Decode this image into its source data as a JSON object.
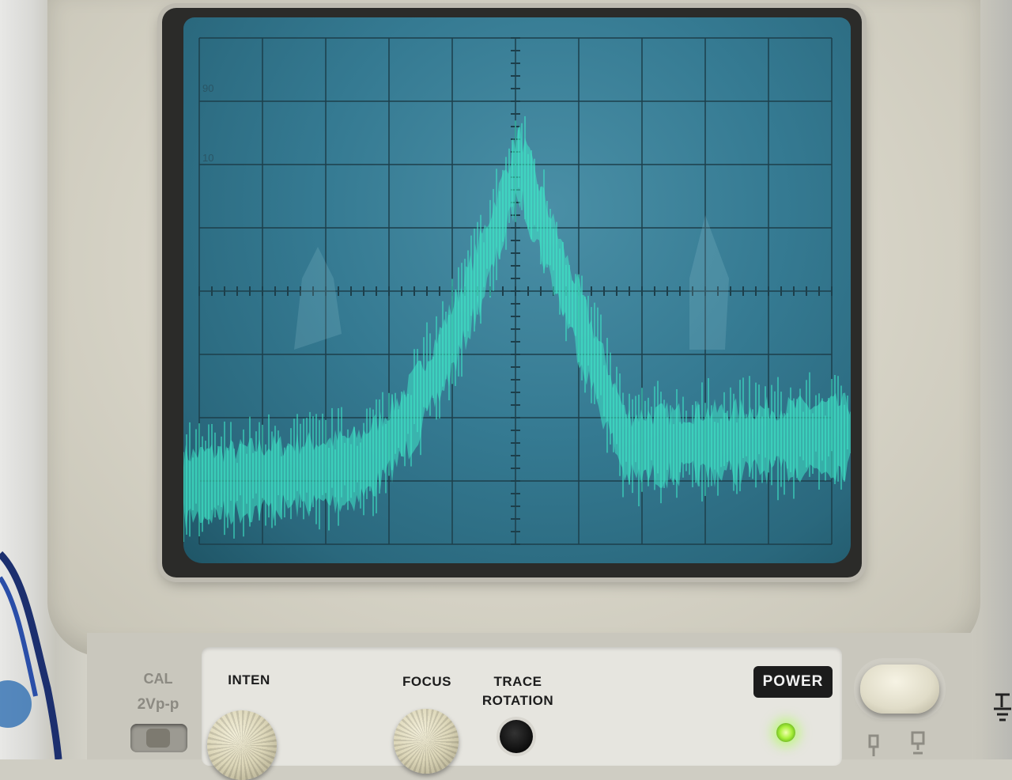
{
  "panel": {
    "cal_label": "CAL",
    "cal_value": "2Vp-p",
    "inten_label": "INTEN",
    "focus_label": "FOCUS",
    "trace_label_line1": "TRACE",
    "trace_label_line2": "ROTATION",
    "power_label": "POWER"
  },
  "graticule": {
    "rows": 8,
    "cols": 10,
    "side_marks": [
      "90",
      "10"
    ]
  },
  "colors": {
    "screen": "#357a92",
    "trace": "#3fe8c8",
    "grid": "#1d3f4b",
    "led": "#a8f03a"
  }
}
